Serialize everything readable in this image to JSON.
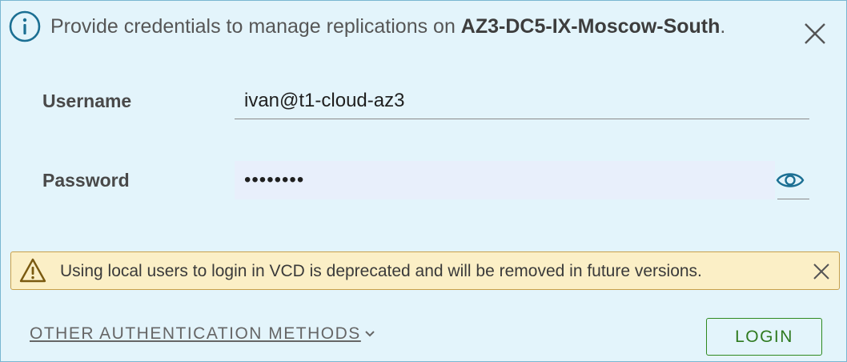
{
  "header": {
    "message_prefix": "Provide credentials to manage replications on ",
    "site_name": "AZ3-DC5-IX-Moscow-South",
    "message_suffix": "."
  },
  "form": {
    "username_label": "Username",
    "username_value": "ivan@t1-cloud-az3",
    "password_label": "Password",
    "password_masked": "••••••••"
  },
  "warning": {
    "text": "Using local users to login in VCD is deprecated and will be removed in future versions."
  },
  "footer": {
    "other_auth_label": "OTHER AUTHENTICATION METHODS",
    "login_label": "LOGIN"
  },
  "icons": {
    "info": "info-icon",
    "close": "close-icon",
    "eye": "eye-icon",
    "warning": "warning-triangle-icon",
    "chevron": "chevron-down-icon"
  },
  "colors": {
    "panel_bg": "#e3f4fb",
    "panel_border": "#79b6d1",
    "info_icon": "#1b6f93",
    "warning_bg": "#fbefc6",
    "warning_border": "#c8a04a",
    "login_accent": "#2f7a1f"
  }
}
